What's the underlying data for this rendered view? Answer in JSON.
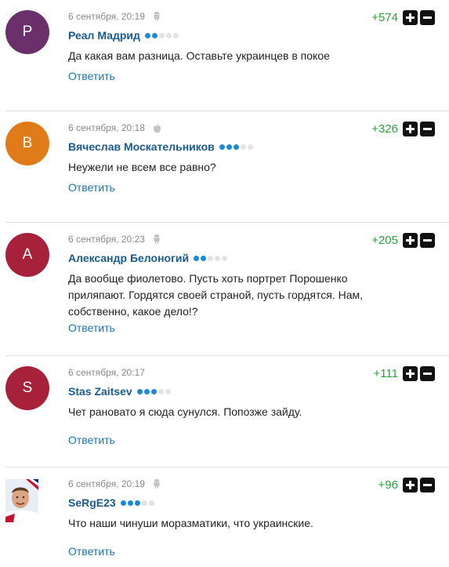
{
  "comments": [
    {
      "date": "6 сентября, 20:19",
      "device": "android-icon",
      "author": "Реал Мадрид",
      "rating_level": 2,
      "text": "Да какая вам разница. Оставьте украинцев в покое",
      "reply_label": "Ответить",
      "score": "+574",
      "avatar": {
        "letter": "Р",
        "color": "#6b2f6b"
      }
    },
    {
      "date": "6 сентября, 20:18",
      "device": "apple-icon",
      "author": "Вячеслав Москательников",
      "rating_level": 3,
      "text": "Неужели не всем все равно?",
      "reply_label": "Ответить",
      "score": "+326",
      "avatar": {
        "letter": "В",
        "color": "#e07b1a"
      }
    },
    {
      "date": "6 сентября, 20:23",
      "device": "android-icon",
      "author": "Александр Белоногий",
      "rating_level": 2,
      "text": "Да вообще фиолетово. Пусть хоть портрет Порошенко приляпают. Гордятся своей страной, пусть гордятся. Нам, собственно, какое дело!?",
      "reply_label": "Ответить",
      "score": "+205",
      "avatar": {
        "letter": "А",
        "color": "#a8213a"
      }
    },
    {
      "date": "6 сентября, 20:17",
      "device": "",
      "author": "Stas Zaitsev",
      "rating_level": 3,
      "text": "Чет рановато я сюда сунулся. Попозже зайду.",
      "reply_label": "Ответить",
      "score": "+111",
      "avatar": {
        "letter": "S",
        "color": "#a8213a"
      }
    },
    {
      "date": "6 сентября, 20:19",
      "device": "android-icon",
      "author": "SeRgE23",
      "rating_level": 3,
      "text": "Что наши чинуши моразматики, что украинские.",
      "reply_label": "Ответить",
      "score": "+96",
      "avatar": {
        "letter": "",
        "color": "#dfe6ef",
        "photo": true
      }
    }
  ],
  "colors": {
    "author": "#1a5a8f",
    "reply": "#1a73b5",
    "score": "#2ea13a",
    "rating_dot": "#1e88d9"
  }
}
